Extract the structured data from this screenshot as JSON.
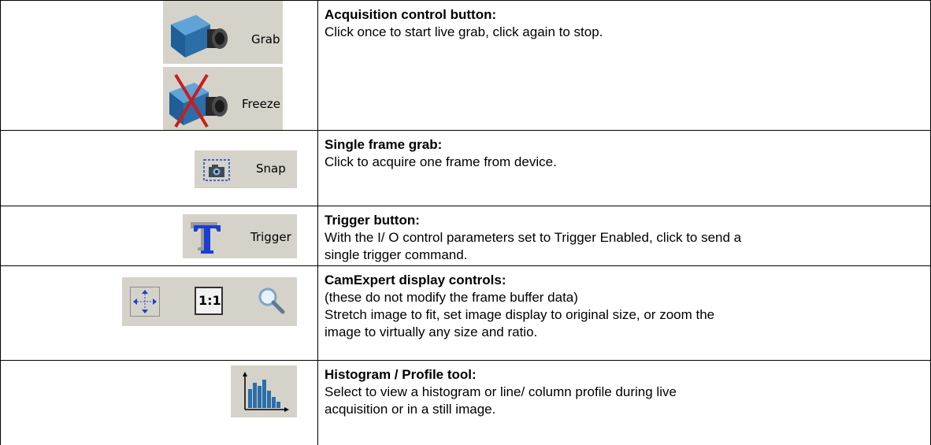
{
  "rows": [
    {
      "title": "Acquisition control button:",
      "lines": [
        "Click once to start live grab, click again to stop."
      ],
      "buttons": {
        "grab_label": "Grab",
        "freeze_label": "Freeze",
        "grab_icon": "camera-icon",
        "freeze_icon": "camera-disabled-icon"
      }
    },
    {
      "title": "Single frame grab:",
      "lines": [
        "Click to acquire one frame from device."
      ],
      "buttons": {
        "snap_label": "Snap",
        "snap_icon": "snap-camera-icon"
      }
    },
    {
      "title": "Trigger button:",
      "lines": [
        "With the I/ O control parameters set to Trigger Enabled, click to send a",
        "single trigger command."
      ],
      "buttons": {
        "trigger_label": "Trigger",
        "trigger_icon": "trigger-t-icon"
      }
    },
    {
      "title": "CamExpert display controls:",
      "lines": [
        "(these do not modify the frame buffer data)",
        "Stretch image to fit, set image display to original size, or zoom the",
        "image to virtually any size and ratio."
      ],
      "buttons": {
        "one_to_one_label": "1:1",
        "fit_icon": "stretch-fit-icon",
        "zoom_icon": "magnifier-icon"
      }
    },
    {
      "title": "Histogram / Profile tool:",
      "lines": [
        "Select to view a histogram or line/ column profile during live",
        "acquisition or in a still image."
      ],
      "buttons": {
        "histogram_icon": "histogram-icon"
      }
    }
  ],
  "colors": {
    "button_face": "#d5d2c9",
    "camera_blue": "#2c6ea8",
    "trigger_blue": "#1a3fd0",
    "cross_red": "#c81e1e"
  }
}
